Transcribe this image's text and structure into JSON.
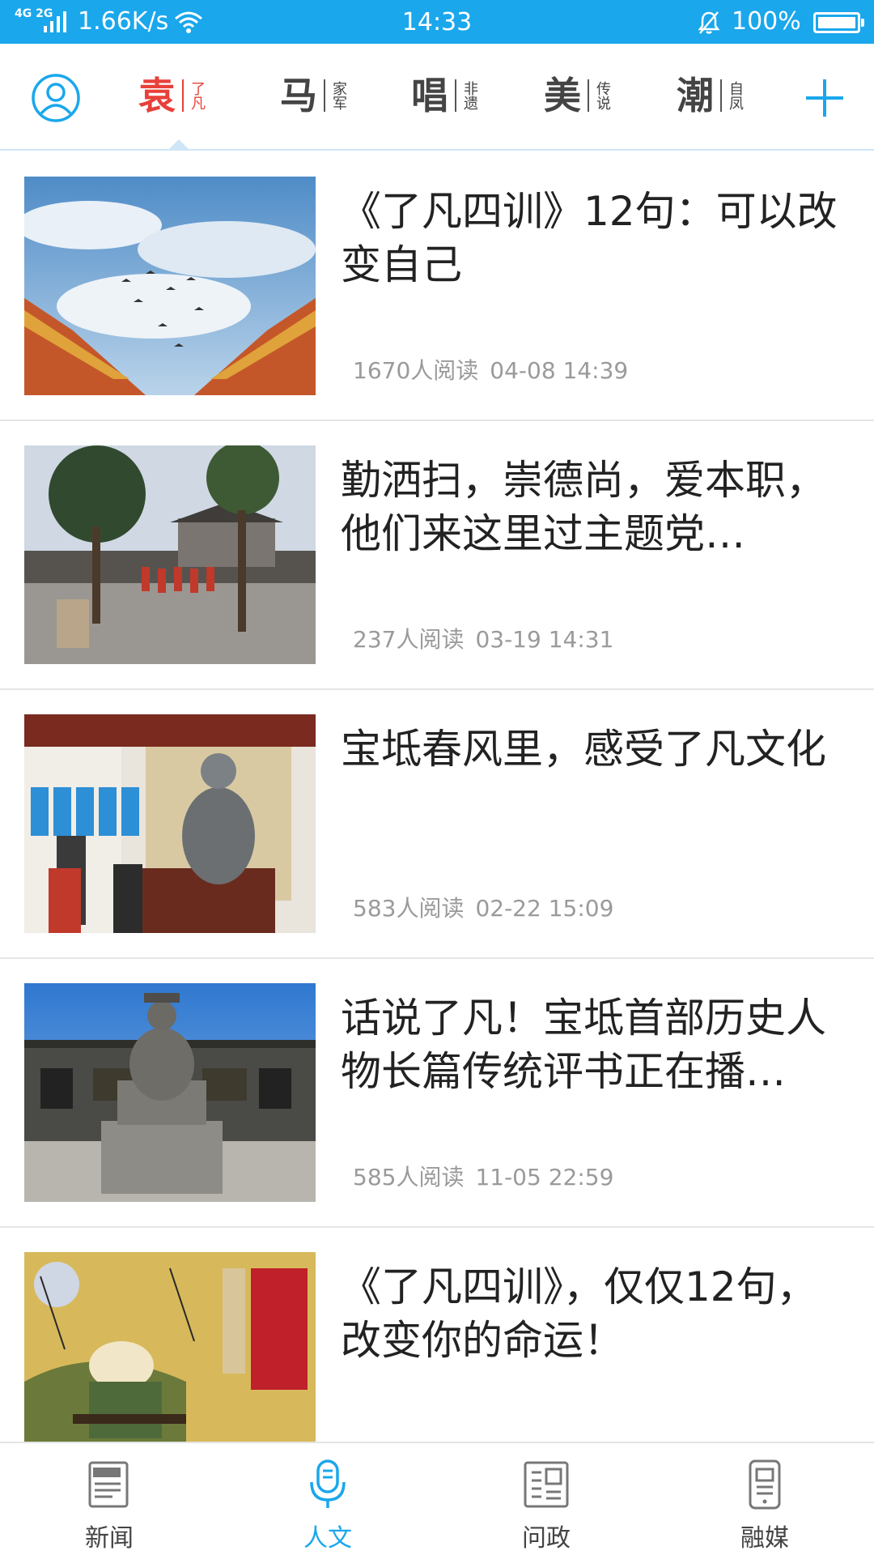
{
  "status_bar": {
    "network": "4G 2G",
    "speed": "1.66K/s",
    "time": "14:33",
    "battery": "100%",
    "color": "#1aa7ec"
  },
  "topbar": {
    "channels": [
      {
        "big": "袁",
        "small": "了凡",
        "active": true
      },
      {
        "big": "马",
        "small": "家军",
        "active": false
      },
      {
        "big": "唱",
        "small": "非遗",
        "active": false
      },
      {
        "big": "美",
        "small": "传说",
        "active": false
      },
      {
        "big": "潮",
        "small": "自凤",
        "active": false
      }
    ],
    "active_color": "#e8403a",
    "accent_color": "#1aa7ec"
  },
  "articles": [
    {
      "title": "《了凡四训》12句：可以改变自己",
      "reads": "1670人阅读",
      "date": "04-08 14:39"
    },
    {
      "title": "勤洒扫，崇德尚，爱本职，他们来这里过主题党…",
      "reads": "237人阅读",
      "date": "03-19 14:31"
    },
    {
      "title": "宝坻春风里，感受了凡文化",
      "reads": "583人阅读",
      "date": "02-22 15:09"
    },
    {
      "title": "话说了凡！宝坻首部历史人物长篇传统评书正在播…",
      "reads": "585人阅读",
      "date": "11-05 22:59"
    },
    {
      "title": "《了凡四训》，仅仅12句，改变你的命运！",
      "reads": "",
      "date": ""
    }
  ],
  "bottom_nav": {
    "items": [
      {
        "label": "新闻",
        "icon": "newspaper-icon",
        "active": false
      },
      {
        "label": "人文",
        "icon": "microphone-icon",
        "active": true
      },
      {
        "label": "问政",
        "icon": "document-icon",
        "active": false
      },
      {
        "label": "融媒",
        "icon": "phone-media-icon",
        "active": false
      }
    ]
  }
}
